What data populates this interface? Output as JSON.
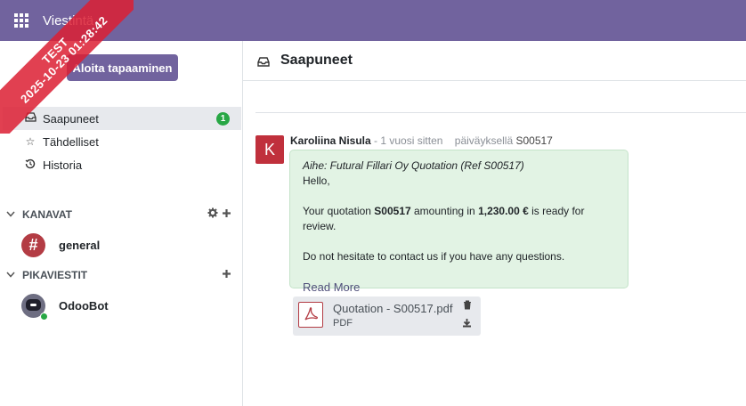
{
  "topbar": {
    "app_title": "Viestintä",
    "ribbon_line1": "TEST",
    "ribbon_line2": "2025-10-23 01:28:42"
  },
  "sidebar": {
    "start_meeting_label": "Aloita tapaaminen",
    "nav": [
      {
        "label": "Saapuneet",
        "icon": "inbox-icon",
        "badge": "1",
        "active": true
      },
      {
        "label": "Tähdelliset",
        "icon": "star-icon"
      },
      {
        "label": "Historia",
        "icon": "history-icon"
      }
    ],
    "channels_section": {
      "label": "KANAVAT",
      "items": [
        {
          "label": "general"
        }
      ]
    },
    "direct_section": {
      "label": "PIKAVIESTIT",
      "items": [
        {
          "label": "OdooBot"
        }
      ]
    }
  },
  "main": {
    "title": "Saapuneet",
    "message": {
      "avatar_letter": "K",
      "author": "Karoliina Nisula",
      "time": "- 1 vuosi sitten",
      "related_prefix": "päiväyksellä",
      "related_ref": "S00517",
      "subject": "Aihe: Futural Fillari Oy Quotation (Ref S00517)",
      "greeting": "Hello,",
      "body_part1": "Your quotation ",
      "body_ref": "S00517",
      "body_part2": " amounting in ",
      "body_amount": "1,230.00 €",
      "body_part3": " is ready for review.",
      "closing": "Do not hesitate to contact us if you have any questions.",
      "read_more": "Read More"
    },
    "attachment": {
      "name": "Quotation - S00517.pdf",
      "type": "PDF"
    }
  },
  "colors": {
    "brand": "#71639e",
    "badge": "#28a745",
    "message_bg": "#e2f3e4",
    "avatar": "#c0303c"
  }
}
